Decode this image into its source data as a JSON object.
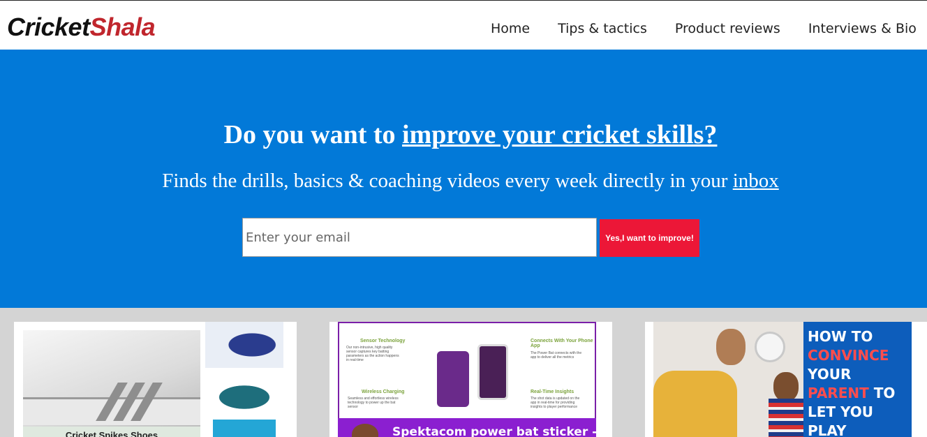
{
  "header": {
    "logo": {
      "part1": "Cricket",
      "part2": "Shala"
    },
    "nav": [
      {
        "label": "Home"
      },
      {
        "label": "Tips & tactics"
      },
      {
        "label": "Product reviews"
      },
      {
        "label": "Interviews & Bio"
      }
    ]
  },
  "hero": {
    "title_prefix": "Do you want to ",
    "title_link": "improve your cricket skills?",
    "subtitle_prefix": "Finds the drills, basics & coaching videos every week directly in your ",
    "subtitle_link": "inbox",
    "email_placeholder": "Enter your email",
    "cta_label": "Yes,I want to improve!",
    "colors": {
      "background": "#0279d8",
      "cta": "#ec1737"
    }
  },
  "cards": {
    "card1": {
      "caption": "Cricket Spikes Shoes"
    },
    "card2": {
      "features": [
        {
          "title": "Sensor Technology",
          "text": "Our non-intrusive, high quality sensor captures key batting parameters as the action happens in real-time"
        },
        {
          "title": "Connects With Your Phone App",
          "text": "The Power Bat connects with the app to deliver all the metrics"
        },
        {
          "title": "Wireless Charging",
          "text": "Seamless and effortless wireless technology to power up the bat sensor"
        },
        {
          "title": "Real-Time Insights",
          "text": "The shot data is updated on the app in real-time for providing insights to player performance"
        }
      ],
      "banner": "Spektacom power bat sticker -"
    },
    "card3": {
      "lines": [
        {
          "white": "HOW TO",
          "red": ""
        },
        {
          "white": "",
          "red": "CONVINCE"
        },
        {
          "white": "YOUR",
          "red": ""
        },
        {
          "white": " TO",
          "red": "PARENT"
        },
        {
          "white": "LET YOU",
          "red": ""
        },
        {
          "white": "PLAY",
          "red": ""
        }
      ]
    }
  }
}
